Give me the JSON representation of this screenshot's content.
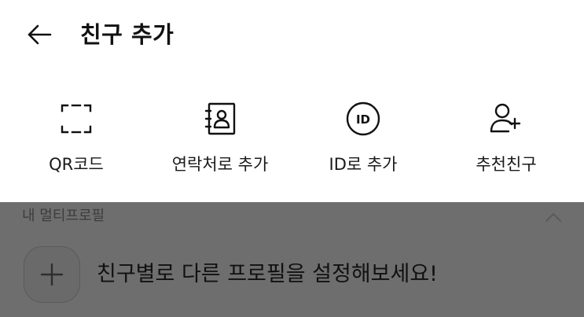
{
  "header": {
    "title": "친구 추가",
    "back_icon": "arrow-left-icon"
  },
  "actions": [
    {
      "label": "QR코드",
      "icon": "qr-scan-icon"
    },
    {
      "label": "연락처로 추가",
      "icon": "contact-book-icon"
    },
    {
      "label": "ID로 추가",
      "icon": "id-badge-icon"
    },
    {
      "label": "추천친구",
      "icon": "person-add-icon"
    }
  ],
  "multi_profile": {
    "section_label": "내 멀티프로필",
    "collapse_icon": "chevron-up-icon",
    "add_icon": "plus-icon",
    "promo_text": "친구별로 다른 프로필을 설정해보세요!"
  },
  "colors": {
    "background": "#ffffff",
    "dim_overlay": "#6e6e6e",
    "text": "#111111"
  }
}
